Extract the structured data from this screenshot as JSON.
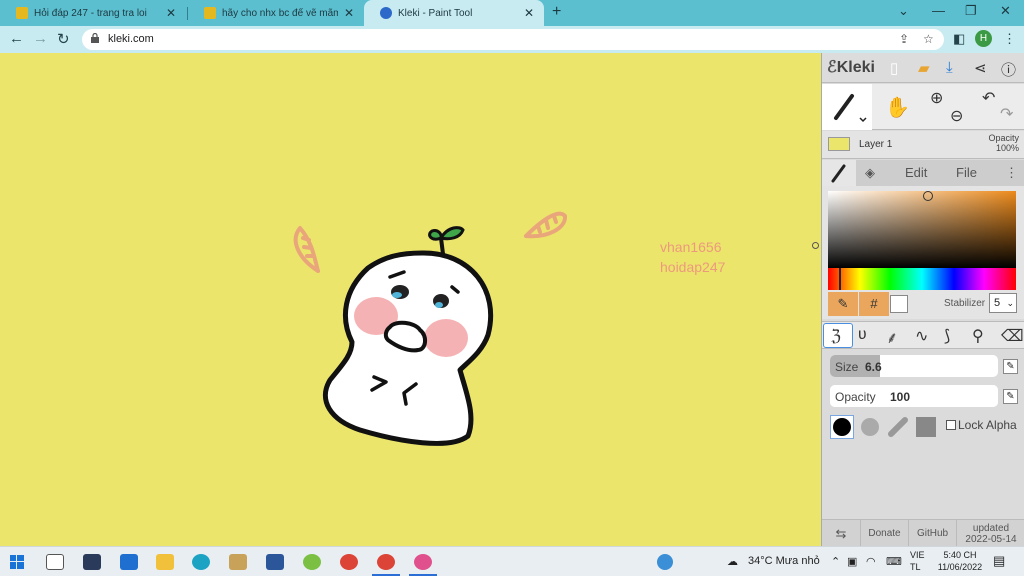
{
  "browser": {
    "tabs": [
      {
        "title": "Hỏi đáp 247 - trang tra loi",
        "active": false
      },
      {
        "title": "hãy cho nhx bc để vẽ mãm đẹp c",
        "active": false
      },
      {
        "title": "Kleki - Paint Tool",
        "active": true
      }
    ],
    "url": "kleki.com",
    "profile_initial": "H"
  },
  "canvas": {
    "background": "#ece56c",
    "watermark": [
      "vhan1656",
      "hoidap247"
    ]
  },
  "kleki": {
    "logo": "Kleki",
    "layer": {
      "name": "Layer 1",
      "opacity_label": "Opacity",
      "opacity_value": "100%"
    },
    "tabs": {
      "edit": "Edit",
      "file": "File"
    },
    "color": {
      "hex_symbol": "#",
      "stabilizer_label": "Stabilizer",
      "stabilizer_value": "5",
      "hue_color": "#ec8a1b"
    },
    "size": {
      "label": "Size",
      "value": "6.6",
      "fraction": 0.18
    },
    "opacity": {
      "label": "Opacity",
      "value": "100",
      "fraction": 1.0
    },
    "lock_alpha": "Lock Alpha",
    "footer": {
      "donate": "Donate",
      "github": "GitHub",
      "updated_label": "updated",
      "updated_date": "2022-05-14"
    }
  },
  "taskbar": {
    "weather": "34°C  Mưa nhỏ",
    "lang": [
      "VIE",
      "TL"
    ],
    "time": "5:40 CH",
    "date": "11/06/2022"
  }
}
